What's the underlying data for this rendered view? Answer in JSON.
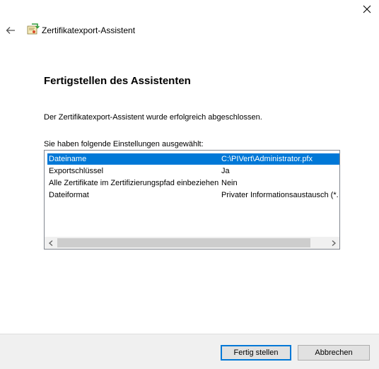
{
  "window": {
    "title": "Zertifikatexport-Assistent",
    "close_glyph": "✕",
    "back_glyph": "←"
  },
  "page": {
    "heading": "Fertigstellen des Assistenten",
    "description": "Der Zertifikatexport-Assistent wurde erfolgreich abgeschlossen.",
    "settings_label": "Sie haben folgende Einstellungen ausgewählt:"
  },
  "settings": {
    "rows": [
      {
        "name": "Dateiname",
        "value": "C:\\PIVert\\Administrator.pfx"
      },
      {
        "name": "Exportschlüssel",
        "value": "Ja"
      },
      {
        "name": "Alle Zertifikate im Zertifizierungspfad einbeziehen",
        "value": "Nein"
      },
      {
        "name": "Dateiformat",
        "value": "Privater Informationsaustausch (*."
      }
    ],
    "scroll_left_glyph": "<",
    "scroll_right_glyph": ">"
  },
  "buttons": {
    "finish": "Fertig stellen",
    "cancel": "Abbrechen"
  },
  "colors": {
    "selection": "#0078d7",
    "footer": "#f0f0f0"
  }
}
